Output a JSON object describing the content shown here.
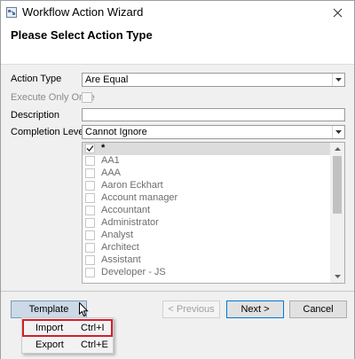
{
  "window": {
    "title": "Workflow Action Wizard",
    "icons": [
      "workflow-app-icon",
      "close-icon"
    ]
  },
  "header": {
    "title": "Please Select Action Type"
  },
  "form": {
    "action_type_label": "Action Type",
    "action_type_value": "Are Equal",
    "execute_once_label": "Execute Only Once",
    "description_label": "Description",
    "description_value": "",
    "completion_level_label": "Completion Level",
    "completion_level_value": "Cannot Ignore"
  },
  "list": {
    "items": [
      {
        "label": "*",
        "checked": true
      },
      {
        "label": "AA1",
        "checked": false
      },
      {
        "label": "AAA",
        "checked": false
      },
      {
        "label": "Aaron Eckhart",
        "checked": false
      },
      {
        "label": "Account manager",
        "checked": false
      },
      {
        "label": "Accountant",
        "checked": false
      },
      {
        "label": "Administrator",
        "checked": false
      },
      {
        "label": "Analyst",
        "checked": false
      },
      {
        "label": "Architect",
        "checked": false
      },
      {
        "label": "Assistant",
        "checked": false
      },
      {
        "label": "Developer - JS",
        "checked": false
      }
    ]
  },
  "footer": {
    "template_label": "Template",
    "previous_label": "< Previous",
    "next_label": "Next >",
    "cancel_label": "Cancel"
  },
  "menu": {
    "items": [
      {
        "label": "Import",
        "shortcut": "Ctrl+I"
      },
      {
        "label": "Export",
        "shortcut": "Ctrl+E"
      }
    ]
  },
  "colors": {
    "highlight_box": "#d0202a",
    "primary_border": "#0078d7",
    "panel_bg": "#f0f0f0"
  }
}
